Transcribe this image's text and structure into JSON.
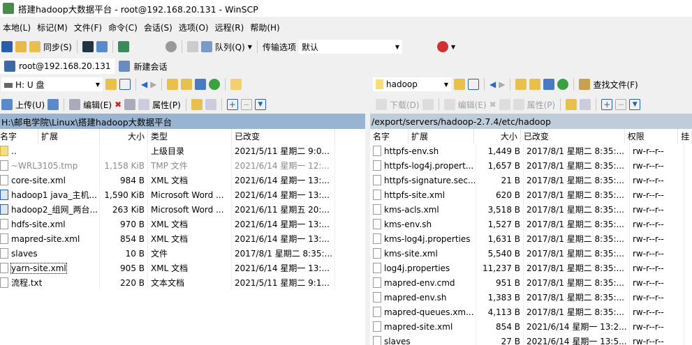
{
  "window": {
    "title": "搭建hadoop大数据平台 - root@192.168.20.131 - WinSCP"
  },
  "menu": [
    "本地(L)",
    "标记(M)",
    "文件(F)",
    "命令(C)",
    "会话(S)",
    "选项(O)",
    "远程(R)",
    "帮助(H)"
  ],
  "toolbar": {
    "sync": "同步(S)",
    "queue": "队列(Q)",
    "transfer_label": "传输选项",
    "transfer_value": "默认"
  },
  "tabs": [
    {
      "label": "root@192.168.20.131"
    },
    {
      "label": "新建会话"
    }
  ],
  "left": {
    "drive": "H: U 盘",
    "upload": "上传(U)",
    "edit": "编辑(E)",
    "props": "属性(P)",
    "path": "H:\\邮电学院\\Linux\\搭建hadoop大数据平台",
    "headers": [
      "名字",
      "扩展",
      "大小",
      "类型",
      "已改变"
    ],
    "rows": [
      {
        "name": "..",
        "size": "",
        "type": "上级目录",
        "changed": "2021/5/11 星期二  9:0..."
      },
      {
        "name": "~WRL3105.tmp",
        "size": "1,158 KiB",
        "type": "TMP 文件",
        "changed": "2021/6/14 星期一  12:..."
      },
      {
        "name": "core-site.xml",
        "size": "984 B",
        "type": "XML 文档",
        "changed": "2021/6/14 星期一  13:..."
      },
      {
        "name": "hadoop1 java_主机...",
        "size": "1,590 KiB",
        "type": "Microsoft Word ...",
        "changed": "2021/6/14 星期一  13:..."
      },
      {
        "name": "hadoop2_组网_两台...",
        "size": "263 KiB",
        "type": "Microsoft Word ...",
        "changed": "2021/6/11 星期五  20:..."
      },
      {
        "name": "hdfs-site.xml",
        "size": "970 B",
        "type": "XML 文档",
        "changed": "2021/6/14 星期一  13:..."
      },
      {
        "name": "mapred-site.xml",
        "size": "854 B",
        "type": "XML 文档",
        "changed": "2021/6/14 星期一  13:..."
      },
      {
        "name": "slaves",
        "size": "10 B",
        "type": "文件",
        "changed": "2017/8/1 星期二  8:35:..."
      },
      {
        "name": "yarn-site.xml",
        "size": "905 B",
        "type": "XML 文档",
        "changed": "2021/6/14 星期一  13:..."
      },
      {
        "name": "流程.txt",
        "size": "220 B",
        "type": "文本文档",
        "changed": "2021/5/11 星期二  9:1..."
      }
    ]
  },
  "right": {
    "dir": "hadoop",
    "find": "查找文件(F)",
    "download": "下载(D)",
    "edit": "编辑(E)",
    "props": "属性(P)",
    "path": "/export/servers/hadoop-2.7.4/etc/hadoop",
    "headers": [
      "名字",
      "扩展",
      "大小",
      "已改变",
      "权限",
      "挂"
    ],
    "rows": [
      {
        "name": "httpfs-env.sh",
        "size": "1,449 B",
        "changed": "2017/8/1 星期二 8:35:...",
        "perm": "rw-r--r--"
      },
      {
        "name": "httpfs-log4j.propert...",
        "size": "1,657 B",
        "changed": "2017/8/1 星期二 8:35:...",
        "perm": "rw-r--r--"
      },
      {
        "name": "httpfs-signature.sec...",
        "size": "21 B",
        "changed": "2017/8/1 星期二 8:35:...",
        "perm": "rw-r--r--"
      },
      {
        "name": "httpfs-site.xml",
        "size": "620 B",
        "changed": "2017/8/1 星期二 8:35:...",
        "perm": "rw-r--r--"
      },
      {
        "name": "kms-acls.xml",
        "size": "3,518 B",
        "changed": "2017/8/1 星期二 8:35:...",
        "perm": "rw-r--r--"
      },
      {
        "name": "kms-env.sh",
        "size": "1,527 B",
        "changed": "2017/8/1 星期二 8:35:...",
        "perm": "rw-r--r--"
      },
      {
        "name": "kms-log4j.properties",
        "size": "1,631 B",
        "changed": "2017/8/1 星期二 8:35:...",
        "perm": "rw-r--r--"
      },
      {
        "name": "kms-site.xml",
        "size": "5,540 B",
        "changed": "2017/8/1 星期二 8:35:...",
        "perm": "rw-r--r--"
      },
      {
        "name": "log4j.properties",
        "size": "11,237 B",
        "changed": "2017/8/1 星期二 8:35:...",
        "perm": "rw-r--r--"
      },
      {
        "name": "mapred-env.cmd",
        "size": "951 B",
        "changed": "2017/8/1 星期二 8:35:...",
        "perm": "rw-r--r--"
      },
      {
        "name": "mapred-env.sh",
        "size": "1,383 B",
        "changed": "2017/8/1 星期二 8:35:...",
        "perm": "rw-r--r--"
      },
      {
        "name": "mapred-queues.xm...",
        "size": "4,113 B",
        "changed": "2017/8/1 星期二 8:35:...",
        "perm": "rw-r--r--"
      },
      {
        "name": "mapred-site.xml",
        "size": "854 B",
        "changed": "2021/6/14 星期一 13:2...",
        "perm": "rw-r--r--"
      },
      {
        "name": "slaves",
        "size": "27 B",
        "changed": "2021/6/14 星期一 13:5...",
        "perm": "rw-r--r--"
      }
    ]
  }
}
